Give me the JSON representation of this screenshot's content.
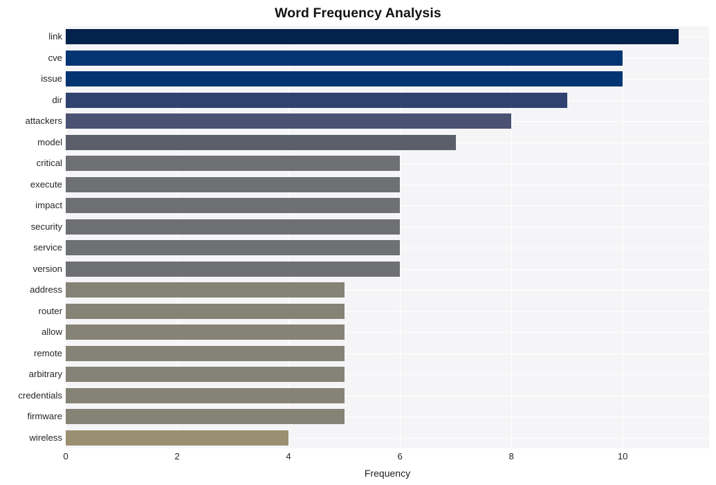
{
  "chart_data": {
    "type": "bar",
    "orientation": "horizontal",
    "title": "Word Frequency Analysis",
    "xlabel": "Frequency",
    "ylabel": "",
    "categories": [
      "link",
      "cve",
      "issue",
      "dir",
      "attackers",
      "model",
      "critical",
      "execute",
      "impact",
      "security",
      "service",
      "version",
      "address",
      "router",
      "allow",
      "remote",
      "arbitrary",
      "credentials",
      "firmware",
      "wireless"
    ],
    "values": [
      11,
      10,
      10,
      9,
      8,
      7,
      6,
      6,
      6,
      6,
      6,
      6,
      5,
      5,
      5,
      5,
      5,
      5,
      5,
      4
    ],
    "bar_colors": [
      "#03224c",
      "#043573",
      "#043573",
      "#2f4270",
      "#4a5173",
      "#5b5e6b",
      "#6e7073",
      "#6e7073",
      "#6e7073",
      "#6e7073",
      "#6e7073",
      "#6e7073",
      "#848375",
      "#848375",
      "#848375",
      "#848375",
      "#848375",
      "#848375",
      "#848375",
      "#9a9071"
    ],
    "xlim": [
      0,
      11.55
    ],
    "x_ticks": [
      0,
      2,
      4,
      6,
      8,
      10
    ],
    "x_tick_labels": [
      "0",
      "2",
      "4",
      "6",
      "8",
      "10"
    ],
    "grid": true,
    "grid_color": "#ffffff",
    "plot_background": "#f5f5f7",
    "figure_background": "#ffffff",
    "legend": null
  }
}
